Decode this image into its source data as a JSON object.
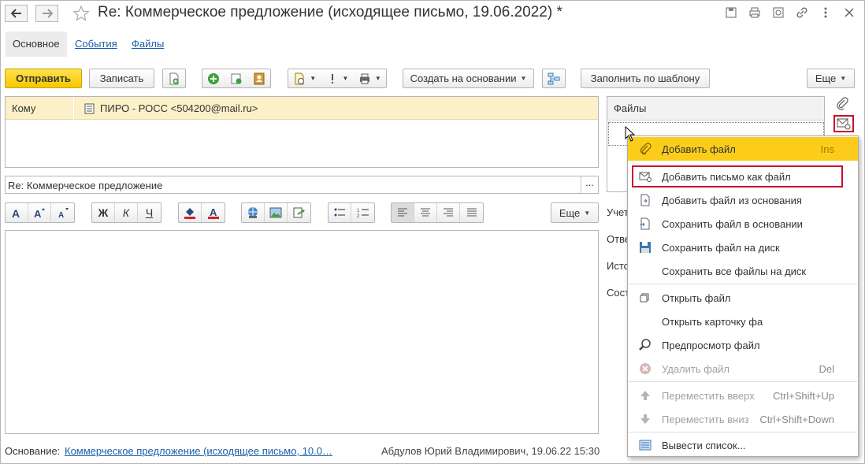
{
  "window": {
    "title": "Re: Коммерческое предложение (исходящее письмо, 19.06.2022) *"
  },
  "tabs": [
    {
      "label": "Основное"
    },
    {
      "label": "События"
    },
    {
      "label": "Файлы"
    }
  ],
  "toolbar": {
    "send_label": "Отправить",
    "save_label": "Записать",
    "create_based_label": "Создать на основании",
    "fill_template_label": "Заполнить по шаблону",
    "more_label": "Еще"
  },
  "recipient": {
    "label": "Кому",
    "value": "ПИРО - РОСС <504200@mail.ru>"
  },
  "subject": {
    "value": "Re: Коммерческое предложение",
    "button": "..."
  },
  "format": {
    "bold": "Ж",
    "italic": "К",
    "underline": "Ч",
    "more_label": "Еще"
  },
  "footer": {
    "basis_label": "Основание:",
    "basis_link": "Коммерческое предложение (исходящее письмо, 10.0…",
    "author": "Абдулов Юрий Владимирович, 19.06.22 15:30"
  },
  "files_panel": {
    "header": "Файлы",
    "side_labels": [
      "Учет",
      "Отве",
      "Исто",
      "Сост"
    ]
  },
  "context_menu": {
    "items": [
      {
        "label": "Добавить файл",
        "shortcut": "Ins",
        "icon": "paperclip-icon"
      },
      {
        "label": "Добавить письмо как файл",
        "shortcut": "",
        "icon": "mail-clip-icon"
      },
      {
        "label": "Добавить файл из основания",
        "shortcut": "",
        "icon": "doc-arrow-icon"
      },
      {
        "label": "Сохранить файл в основании",
        "shortcut": "",
        "icon": "doc-save-icon"
      },
      {
        "label": "Сохранить файл на диск",
        "shortcut": "",
        "icon": "floppy-icon"
      },
      {
        "label": "Сохранить все файлы на диск",
        "shortcut": "",
        "icon": ""
      },
      {
        "label": "Открыть файл",
        "shortcut": "",
        "icon": "open-icon"
      },
      {
        "label": "Открыть карточку фа",
        "shortcut": "",
        "icon": ""
      },
      {
        "label": "Предпросмотр файл",
        "shortcut": "",
        "icon": "magnifier-icon"
      },
      {
        "label": "Удалить файл",
        "shortcut": "Del",
        "icon": "delete-icon"
      },
      {
        "label": "Переместить вверх",
        "shortcut": "Ctrl+Shift+Up",
        "icon": "arrow-up-icon"
      },
      {
        "label": "Переместить вниз",
        "shortcut": "Ctrl+Shift+Down",
        "icon": "arrow-down-icon"
      },
      {
        "label": "Вывести список...",
        "shortcut": "",
        "icon": "list-output-icon"
      }
    ]
  },
  "colors": {
    "accent_yellow": "#fbcd1a",
    "highlight_red": "#c8102e",
    "link_blue": "#1a5fa8",
    "to_row_bg": "#fbf0c7"
  }
}
